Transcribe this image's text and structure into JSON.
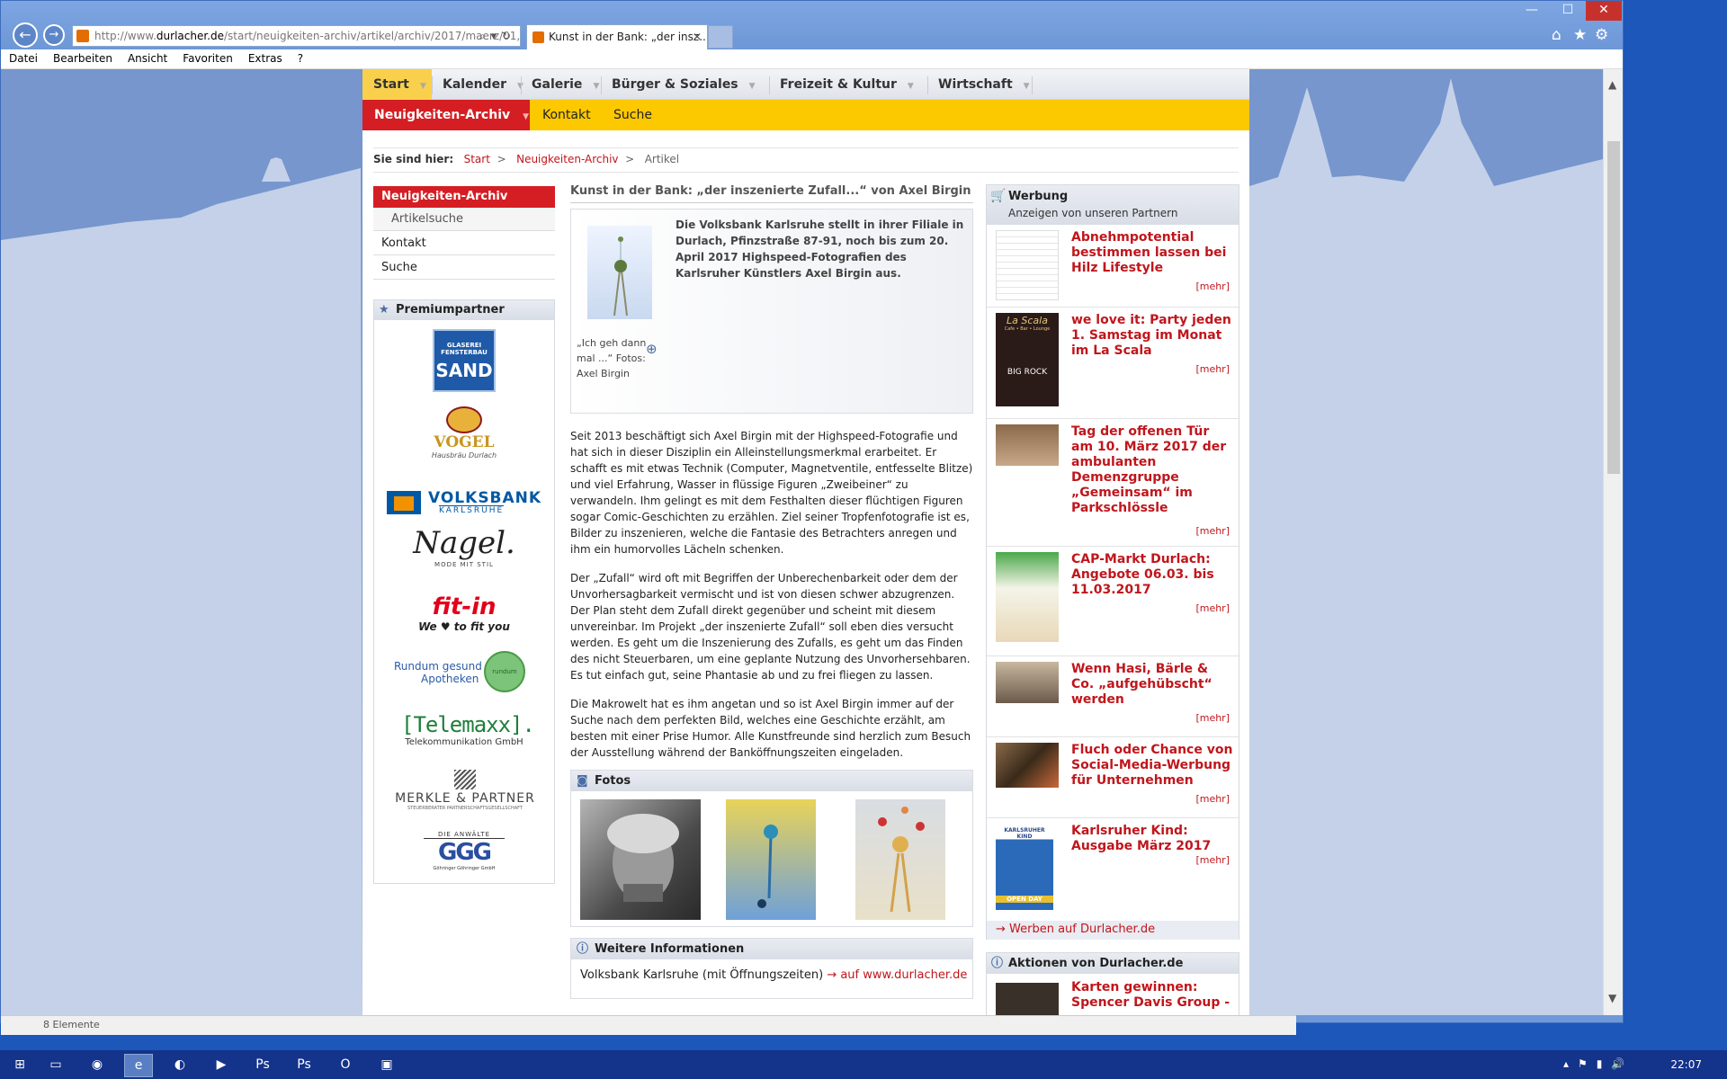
{
  "browser": {
    "url_prefix": "http://www.",
    "url_domain": "durlacher.de",
    "url_path": "/start/neuigkeiten-archiv/artikel/archiv/2017/maerz/01,",
    "tab_title": "Kunst in der Bank: „der insz...",
    "menu": [
      "Datei",
      "Bearbeiten",
      "Ansicht",
      "Favoriten",
      "Extras",
      "?"
    ],
    "status": "8 Elemente"
  },
  "nav": {
    "main": [
      "Start",
      "Kalender",
      "Galerie",
      "Bürger & Soziales",
      "Freizeit & Kultur",
      "Wirtschaft"
    ],
    "sub_active": "Neuigkeiten-Archiv",
    "sub_links": [
      "Kontakt",
      "Suche"
    ]
  },
  "breadcrumb": {
    "label": "Sie sind hier:",
    "items": [
      "Start",
      "Neuigkeiten-Archiv",
      "Artikel"
    ],
    "sep": ">"
  },
  "sidebar": {
    "header": "Neuigkeiten-Archiv",
    "sub": "Artikelsuche",
    "items": [
      "Kontakt",
      "Suche"
    ],
    "partner_header": "Premiumpartner",
    "partners": {
      "sand_line1": "GLASEREI",
      "sand_line2": "FENSTERBAU",
      "sand_name": "SAND",
      "vogel": "VOGEL",
      "vogel_sub": "Hausbräu Durlach",
      "volksbank": "VOLKSBANK",
      "volksbank_sub": "KARLSRUHE",
      "nagel": "Nagel.",
      "nagel_sub": "MODE MIT STIL",
      "fitin": "fit-in",
      "fitin_sub": "We ♥ to fit you",
      "rundum1": "Rundum gesund",
      "rundum2": "Apotheken",
      "rundum_badge": "rundum gesund",
      "telemaxx": "[Telemaxx].",
      "telemaxx_sub": "Telekommunikation GmbH",
      "merkle": "MERKLE & PARTNER",
      "merkle_sub": "STEUERBERATER PARTNERSCHAFTSGESELLSCHAFT",
      "ggg_top": "DIE ANWÄLTE",
      "ggg": "GGG",
      "ggg_sub": "Göhringer Göhringer GmbH"
    }
  },
  "article": {
    "title": "Kunst in der Bank: „der inszenierte Zufall...“ von Axel Birgin",
    "caption": "„Ich geh dann mal ...“ Fotos: Axel Birgin",
    "lead": "Die Volksbank Karlsruhe stellt in ihrer Filiale in Durlach, Pfinzstraße 87-91, noch bis zum 20. April 2017 Highspeed-Fotografien des Karlsruher Künstlers Axel Birgin aus.",
    "p1": "Seit 2013 beschäftigt sich Axel Birgin mit der Highspeed-Fotografie und hat sich in dieser Disziplin ein Alleinstellungsmerkmal erarbeitet. Er schafft es mit etwas Technik (Computer, Magnetventile, entfesselte Blitze) und viel Erfahrung, Wasser in flüssige Figuren „Zweibeiner“ zu verwandeln. Ihm gelingt es mit dem Festhalten dieser flüchtigen Figuren sogar Comic-Geschichten zu erzählen. Ziel seiner Tropfenfotografie ist es, Bilder zu inszenieren, welche die Fantasie des Betrachters anregen und ihm ein humorvolles Lächeln schenken.",
    "p2": "Der „Zufall“ wird oft mit Begriffen der Unberechenbarkeit oder dem der Unvorhersagbarkeit vermischt und ist von diesen schwer abzugrenzen. Der Plan steht dem Zufall direkt gegenüber und scheint mit diesem unvereinbar. Im Projekt „der inszenierte Zufall“ soll eben dies versucht werden. Es geht um die Inszenierung des Zufalls, es geht um das Finden des nicht Steuerbaren, um eine geplante Nutzung des Unvorhersehbaren. Es tut einfach gut, seine Phantasie ab und zu frei fliegen zu lassen.",
    "p3": "Die Makrowelt hat es ihm angetan und so ist Axel Birgin immer auf der Suche nach dem perfekten Bild, welches eine Geschichte erzählt, am besten mit einer Prise Humor. Alle Kunstfreunde sind herzlich zum Besuch der Ausstellung während der Banköffnungszeiten eingeladen.",
    "fotos_header": "Fotos",
    "info_header": "Weitere Informationen",
    "info_text": "Volksbank Karlsruhe (mit Öffnungszeiten)",
    "info_link": "→ auf www.durlacher.de"
  },
  "ads": {
    "header": "Werbung",
    "subheader": "Anzeigen von unseren Partnern",
    "more": "[mehr]",
    "items": [
      "Abnehmpotential bestimmen lassen bei Hilz Lifestyle",
      "we love it: Party jeden 1. Samstag im Monat im La Scala",
      "Tag der offenen Tür am 10. März 2017 der ambulanten Demenzgruppe „Gemeinsam“ im Parkschlössle",
      "CAP-Markt Durlach: Angebote 06.03. bis 11.03.2017",
      "Wenn Hasi, Bärle & Co. „aufgehübscht“ werden",
      "Fluch oder Chance von Social-Media-Werbung für Unternehmen",
      "Karlsruher Kind: Ausgabe März 2017"
    ],
    "thumb_lascala": "La Scala",
    "thumb_lascala_sub": "Cafe • Bar • Lounge",
    "thumb_lascala_event": "BIG ROCK",
    "thumb_kind": "KARLSRUHER KIND",
    "thumb_kind_open": "OPEN DAY",
    "werben_link": "→ Werben auf Durlacher.de"
  },
  "aktionen": {
    "header": "Aktionen von Durlacher.de",
    "item": "Karten gewinnen: Spencer Davis Group -"
  },
  "taskbar": {
    "clock": "22:07"
  }
}
